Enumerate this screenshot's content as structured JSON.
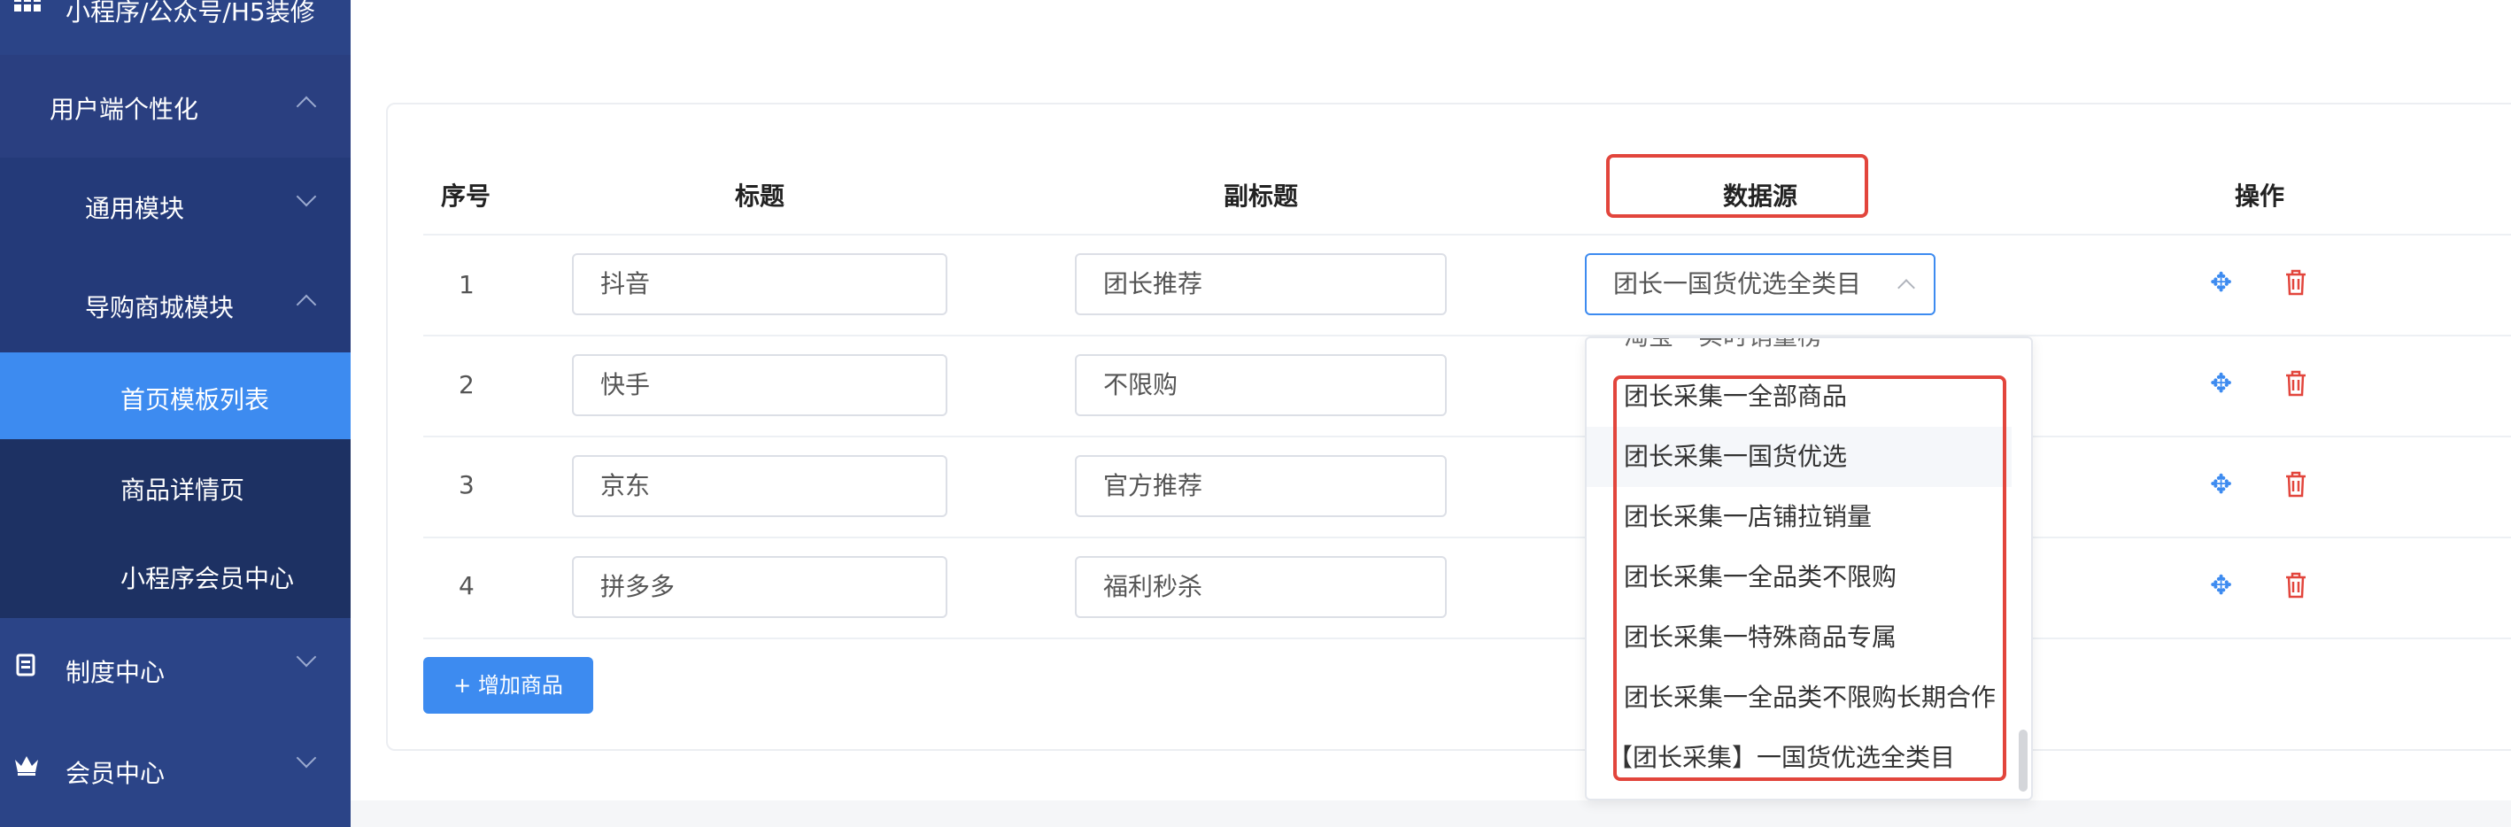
{
  "sidebar": {
    "top_partial": "小程序/公众号/H5装修",
    "user_personalization": "用户端个性化",
    "common_module": "通用模块",
    "guide_mall_module": "导购商城模块",
    "home_template_list": "首页模板列表",
    "product_detail": "商品详情页",
    "mini_member_center": "小程序会员中心",
    "policy_center": "制度中心",
    "member_center": "会员中心"
  },
  "table": {
    "headers": {
      "index": "序号",
      "title": "标题",
      "subtitle": "副标题",
      "source": "数据源",
      "action": "操作"
    },
    "rows": [
      {
        "index": "1",
        "title": "抖音",
        "subtitle": "团长推荐",
        "source": "团长一国货优选全类目"
      },
      {
        "index": "2",
        "title": "快手",
        "subtitle": "不限购"
      },
      {
        "index": "3",
        "title": "京东",
        "subtitle": "官方推荐"
      },
      {
        "index": "4",
        "title": "拼多多",
        "subtitle": "福利秒杀"
      }
    ],
    "add_button": "+ 增加商品"
  },
  "dropdown": {
    "partial_top": "淘宝一实时销量榜",
    "options": [
      "团长采集一全部商品",
      "团长采集一国货优选",
      "团长采集一店铺拉销量",
      "团长采集一全品类不限购",
      "团长采集一特殊商品专属",
      "团长采集一全品类不限购长期合作",
      "【团长采集】一国货优选全类目"
    ]
  },
  "colors": {
    "sidebar_bg": "#2b4487",
    "active_item": "#3d8bf0",
    "highlight_red": "#e2453c",
    "primary": "#3d8bf0"
  }
}
